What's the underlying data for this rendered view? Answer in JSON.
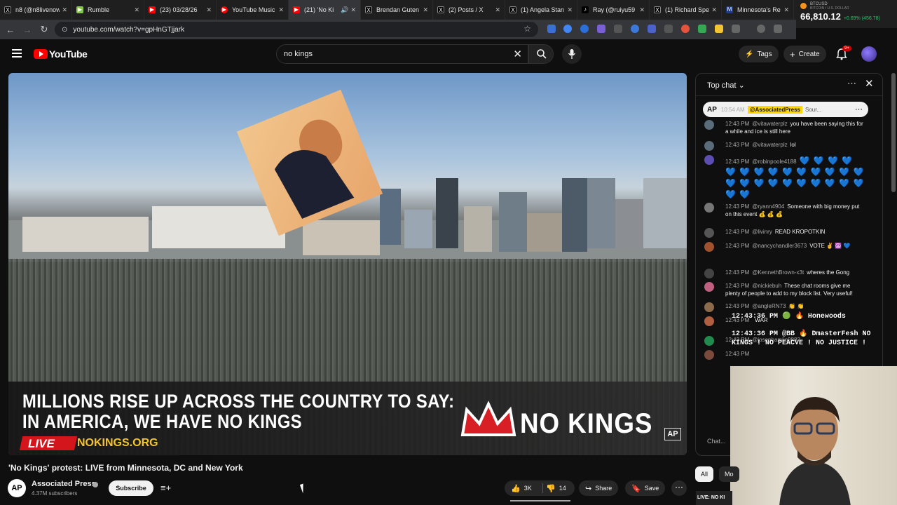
{
  "browser": {
    "tabs": [
      {
        "label": "n8 (@n8livenow",
        "color": "#000000",
        "icon": "x-icon"
      },
      {
        "label": "Rumble",
        "color": "#85c742",
        "icon": "rumble-icon"
      },
      {
        "label": "(23) 03/28/26",
        "color": "#ff0000",
        "icon": "youtube-icon"
      },
      {
        "label": "YouTube Music",
        "color": "#ff0000",
        "icon": "youtube-music-icon"
      },
      {
        "label": "(21) 'No Ki",
        "color": "#ff0000",
        "icon": "youtube-icon",
        "active": true
      },
      {
        "label": "Brendan Guten",
        "color": "#000000",
        "icon": "x-icon"
      },
      {
        "label": "(2) Posts / X",
        "color": "#000000",
        "icon": "x-icon"
      },
      {
        "label": "(1) Angela Stan",
        "color": "#000000",
        "icon": "x-icon"
      },
      {
        "label": "Ray (@ruiyu59",
        "color": "#000000",
        "icon": "tiktok-icon"
      },
      {
        "label": "(1) Richard Spe",
        "color": "#000000",
        "icon": "x-icon"
      },
      {
        "label": "Minnesota's Re",
        "color": "#1f3a8a",
        "icon": "news-icon"
      }
    ],
    "url": "youtube.com/watch?v=gpHnGTjjark",
    "ticker": {
      "symbol": "BTCUSD",
      "subtitle": "BITCOIN / U.S. DOLLAR",
      "price": "66,810.12",
      "change": "+0.69% (456.78)"
    }
  },
  "header": {
    "logo": "YouTube",
    "search_query": "no kings",
    "tags_label": "Tags",
    "create_label": "Create",
    "notifications_badge": "9+"
  },
  "video": {
    "headline_line1": "MILLIONS RISE UP ACROSS THE COUNTRY TO SAY:",
    "headline_line2": "IN AMERICA, WE HAVE NO KINGS",
    "live_tag": "LIVE",
    "site": "NOKINGS.ORG",
    "brand": "NO KINGS",
    "ap_mark": "AP"
  },
  "meta": {
    "title": "'No Kings' protest: LIVE from Minnesota, DC and New York",
    "channel": "Associated Press",
    "channel_initials": "AP",
    "subscribers": "4.37M subscribers",
    "subscribe_label": "Subscribe",
    "likes": "3K",
    "dislikes": "14",
    "share_label": "Share",
    "save_label": "Save"
  },
  "chat": {
    "header": "Top chat",
    "pinned": {
      "initials": "AP",
      "time": "10:54 AM",
      "author": "@AssociatedPress",
      "text": "Sour..."
    },
    "messages": [
      {
        "time": "12:43 PM",
        "author": "@vitawaterplz",
        "text": "you have been saying this for a while and ice is still here",
        "color": "#5a6b7a"
      },
      {
        "time": "12:43 PM",
        "author": "@vitawaterplz",
        "text": "lol",
        "color": "#5a6b7a"
      },
      {
        "time": "12:43 PM",
        "author": "@robinpoole4188",
        "text": "💙 💙 💙 💙 💙 💙 💙 💙 💙 💙 💙 💙 💙 💙 💙 💙 💙 💙 💙 💙 💙 💙 💙 💙 💙 💙",
        "color": "#5c4db1"
      },
      {
        "time": "12:43 PM",
        "author": "@ryann4904",
        "text": "Someone with big money put on this event 💰 💰 💰",
        "color": "#777777"
      },
      {
        "time": "12:43 PM",
        "author": "@livinry",
        "text": "READ KROPOTKIN",
        "color": "#555555"
      },
      {
        "time": "12:43 PM",
        "author": "@nancychandler3673",
        "text": "VOTE ✌️ ☮️ 💙",
        "color": "#a0522d"
      },
      {
        "time": "12:43 PM",
        "author": "@KennethBrown-x3t",
        "text": "wheres the Gong",
        "color": "#444444"
      },
      {
        "time": "12:43 PM",
        "author": "@nickiebuh",
        "text": "These chat rooms give me plenty of people to add to my block list. Very useful!",
        "color": "#c06080"
      },
      {
        "time": "12:43 PM",
        "author": "@angleRN73",
        "text": "👏 👏",
        "color": "#8b6b4b"
      },
      {
        "time": "12:43 PM",
        "author": "",
        "text": "WAR",
        "color": "#b06040"
      },
      {
        "time": "12:43 PM",
        "author": "@josephamijo9882",
        "text": "",
        "color": "#1f8b4c"
      },
      {
        "time": "12:43 PM",
        "author": "",
        "text": "",
        "color": "#7a4a3a"
      }
    ],
    "overlay_line1": "12:43:36 PM 🟢 🔥 Honewoods",
    "overlay_line2": "12:43:36 PM @BB 🔥 DmasterFesh  NO",
    "overlay_line3": "KINGS ! NO PEACVE ! NO JUSTICE !",
    "input_placeholder": "Chat...",
    "chip_all": "All",
    "chip_more": "Mo",
    "mini_thumb": "LIVE: NO KI"
  }
}
